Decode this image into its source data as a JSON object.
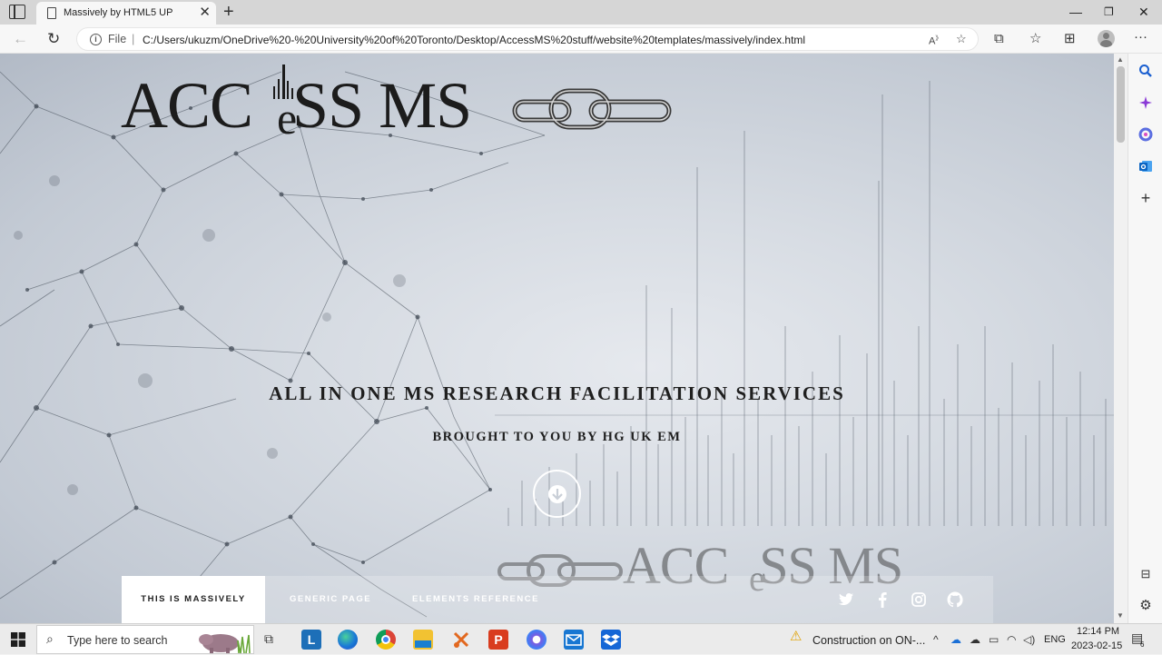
{
  "browser": {
    "tab_title": "Massively by HTML5 UP",
    "url_scheme": "File",
    "url": "C:/Users/ukuzm/OneDrive%20-%20University%20of%20Toronto/Desktop/AccessMS%20stuff/website%20templates/massively/index.html"
  },
  "page": {
    "logo": {
      "main": "ACC",
      "tail": "SS MS",
      "e": "e"
    },
    "headline": "ALL IN ONE MS RESEARCH FACILITATION SERVICES",
    "subhead": "BROUGHT TO YOU BY HG UK EM",
    "nav": {
      "items": [
        "THIS IS MASSIVELY",
        "GENERIC PAGE",
        "ELEMENTS REFERENCE"
      ],
      "social_icons": [
        "twitter-icon",
        "facebook-icon",
        "instagram-icon",
        "github-icon"
      ]
    },
    "accent_colors": {
      "nav_active_bg": "#ffffff",
      "text_dark": "#1f1f1f"
    }
  },
  "taskbar": {
    "search_placeholder": "Type here to search",
    "notification": "Construction on ON-...",
    "language": "ENG",
    "time": "12:14 PM",
    "date": "2023-02-15",
    "notification_count": "6"
  }
}
